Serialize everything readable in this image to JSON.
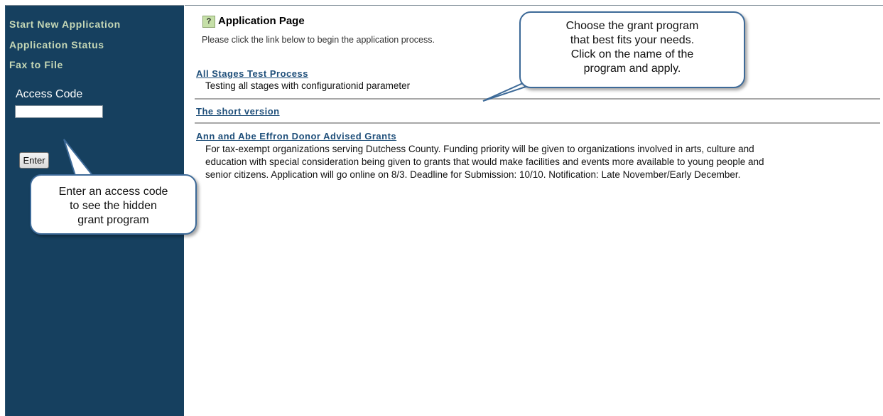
{
  "sidebar": {
    "nav": [
      {
        "label": "Start New Application"
      },
      {
        "label": "Application Status"
      },
      {
        "label": "Fax to File"
      }
    ],
    "access_code_label": "Access Code",
    "access_code_value": "",
    "enter_label": "Enter"
  },
  "main": {
    "help_label": "?",
    "title": "Application Page",
    "intro": "Please click the link below to begin the application process.",
    "programs": [
      {
        "name": "All Stages Test Process",
        "description": "Testing all stages with configurationid parameter"
      },
      {
        "name": "The short version",
        "description": ""
      },
      {
        "name": "Ann and Abe Effron Donor Advised Grants",
        "description_lines": [
          "For tax-exempt organizations serving Dutchess County. Funding priority will be given to organizations involved in arts, culture and",
          "education with special consideration being given to grants that would make facilities and events more available to young people and",
          "senior citizens. Application will go online on 8/3. Deadline for Submission: 10/10. Notification: Late November/Early December."
        ]
      }
    ]
  },
  "callouts": {
    "grant_program": [
      "Choose the grant program",
      "that best fits your needs.",
      "Click on the name of the",
      "program and apply."
    ],
    "access_code": [
      "Enter an access code",
      "to see the hidden",
      "grant program"
    ]
  },
  "colors": {
    "sidebar_bg": "#16405f",
    "sidebar_link": "#c6d8b6",
    "program_link": "#1f4f7a",
    "callout_border": "#3d6a98"
  }
}
